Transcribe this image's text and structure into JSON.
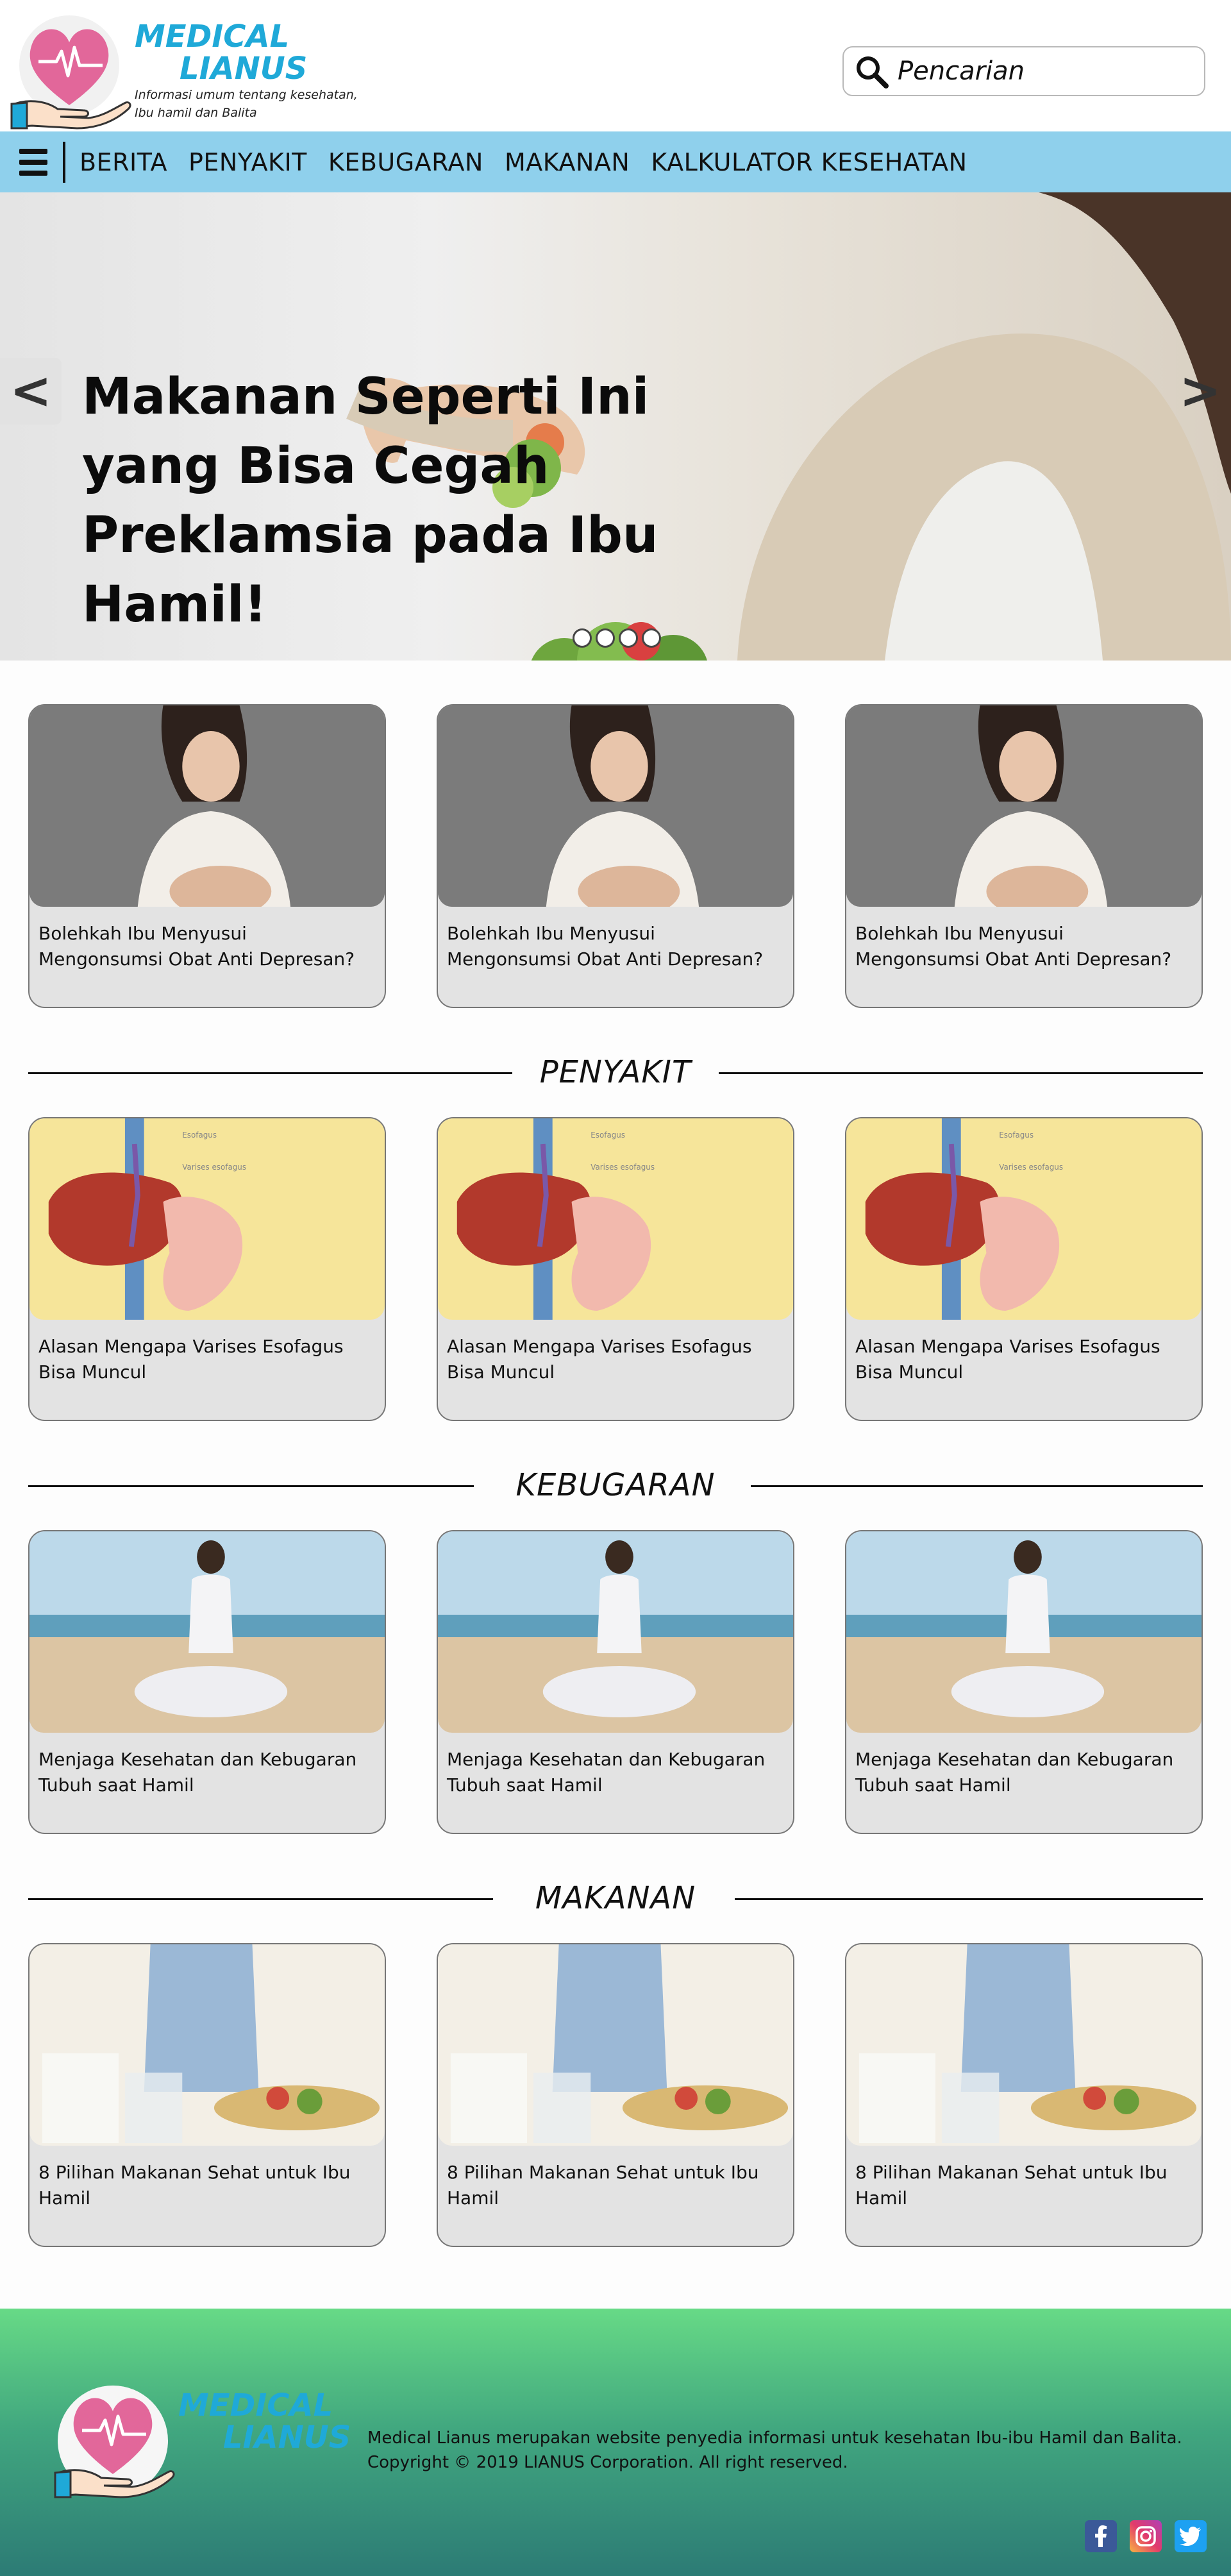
{
  "brand": {
    "title_line1": "MEDICAL",
    "title_line2": "LIANUS",
    "tagline_line1": "Informasi umum tentang kesehatan,",
    "tagline_line2": "Ibu hamil dan Balita"
  },
  "search": {
    "placeholder": "Pencarian"
  },
  "nav": {
    "menu_icon": "hamburger-icon",
    "items": [
      "BERITA",
      "PENYAKIT",
      "KEBUGARAN",
      "MAKANAN",
      "KALKULATOR KESEHATAN"
    ]
  },
  "hero": {
    "title": "Makanan Seperti Ini yang Bisa Cegah Preklamsia pada Ibu Hamil!",
    "prev": "<",
    "next": ">",
    "slide_count": 4
  },
  "sections": [
    {
      "heading": "",
      "cards": [
        {
          "title": "Bolehkah Ibu Menyusui Mengonsumsi Obat Anti Depresan?"
        },
        {
          "title": "Bolehkah Ibu Menyusui Mengonsumsi Obat Anti Depresan?"
        },
        {
          "title": "Bolehkah Ibu Menyusui Mengonsumsi Obat Anti Depresan?"
        }
      ]
    },
    {
      "heading": "PENYAKIT",
      "cards": [
        {
          "title": "Alasan Mengapa Varises Esofagus Bisa Muncul"
        },
        {
          "title": "Alasan Mengapa Varises Esofagus Bisa Muncul"
        },
        {
          "title": "Alasan Mengapa Varises Esofagus Bisa Muncul"
        }
      ],
      "image_labels": [
        "Esofagus",
        "Varises esofagus"
      ]
    },
    {
      "heading": "KEBUGARAN",
      "cards": [
        {
          "title": "Menjaga Kesehatan dan Kebugaran Tubuh saat Hamil"
        },
        {
          "title": "Menjaga Kesehatan dan Kebugaran Tubuh saat Hamil"
        },
        {
          "title": "Menjaga Kesehatan dan Kebugaran Tubuh saat Hamil"
        }
      ]
    },
    {
      "heading": "MAKANAN",
      "cards": [
        {
          "title": "8 Pilihan Makanan Sehat untuk Ibu Hamil"
        },
        {
          "title": "8 Pilihan Makanan Sehat untuk Ibu Hamil"
        },
        {
          "title": "8 Pilihan Makanan Sehat untuk Ibu Hamil"
        }
      ]
    }
  ],
  "footer": {
    "description": "Medical Lianus merupakan website penyedia informasi untuk kesehatan Ibu-ibu Hamil dan Balita.",
    "copyright": "Copyright © 2019 LIANUS Corporation. All right reserved.",
    "social": [
      "facebook-icon",
      "instagram-icon",
      "twitter-icon"
    ]
  },
  "colors": {
    "brand_blue": "#1fa9d8",
    "brand_pink": "#e2679a",
    "nav_bg": "#8fd0ec",
    "card_bg": "#e3e3e3",
    "footer_top": "#67da86",
    "footer_bottom": "#2c7b75"
  }
}
